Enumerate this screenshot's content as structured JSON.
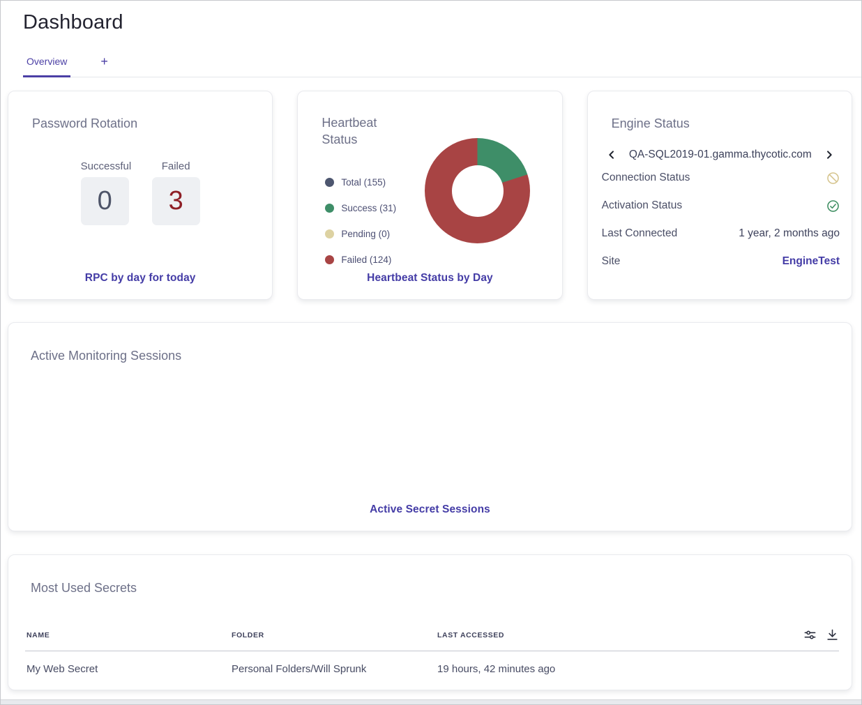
{
  "page": {
    "title": "Dashboard"
  },
  "tabs": {
    "overview": "Overview",
    "add": "+"
  },
  "accent_color": "#4b3fa5",
  "password_rotation": {
    "title": "Password Rotation",
    "stats": [
      {
        "label": "Successful",
        "value": "0",
        "color": "#4e5468"
      },
      {
        "label": "Failed",
        "value": "3",
        "color": "#8e1f26"
      }
    ],
    "link": "RPC by day for today"
  },
  "heartbeat": {
    "title": "Heartbeat Status",
    "legend": [
      {
        "label": "Total (155)",
        "color": "#4d566f"
      },
      {
        "label": "Success (31)",
        "color": "#3e8e68"
      },
      {
        "label": "Pending (0)",
        "color": "#ddd2a2"
      },
      {
        "label": "Failed (124)",
        "color": "#a84444"
      }
    ],
    "link": "Heartbeat Status by Day"
  },
  "chart_data": {
    "type": "pie",
    "title": "Heartbeat Status",
    "labels": [
      "Total",
      "Success",
      "Pending",
      "Failed"
    ],
    "values": [
      155,
      31,
      0,
      124
    ],
    "segments": [
      {
        "label": "Success",
        "value": 31,
        "color": "#3e8e68"
      },
      {
        "label": "Pending",
        "value": 0,
        "color": "#ddd2a2"
      },
      {
        "label": "Failed",
        "value": 124,
        "color": "#a84444"
      }
    ],
    "donut_hole_ratio": 0.49,
    "legend_position": "left",
    "start_angle_deg": 0
  },
  "engine_status": {
    "title": "Engine Status",
    "engine_name": "QA-SQL2019-01.gamma.thycotic.com",
    "connection_status_label": "Connection Status",
    "connection_icon_color": "#d6c58f",
    "activation_status_label": "Activation Status",
    "activation_icon_color": "#3f8f63",
    "last_connected_label": "Last Connected",
    "last_connected_value": "1 year, 2 months ago",
    "site_label": "Site",
    "site_value": "EngineTest"
  },
  "active_monitoring": {
    "title": "Active Monitoring Sessions",
    "link": "Active Secret Sessions"
  },
  "most_used_secrets": {
    "title": "Most Used Secrets",
    "columns": [
      "NAME",
      "FOLDER",
      "LAST ACCESSED"
    ],
    "rows": [
      {
        "name": "My Web Secret",
        "folder": "Personal Folders/Will Sprunk",
        "last_accessed": "19 hours, 42 minutes ago"
      }
    ]
  }
}
